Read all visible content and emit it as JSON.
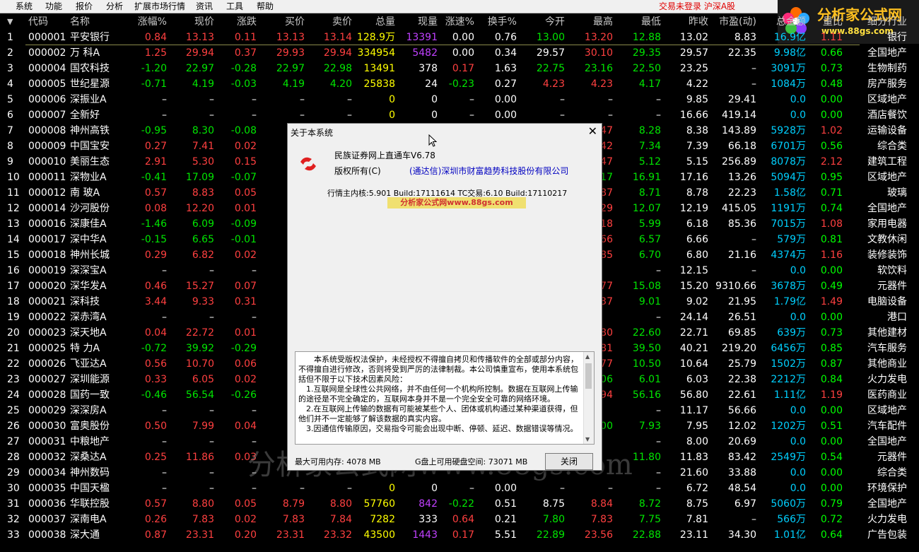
{
  "menu": [
    "系统",
    "功能",
    "报价",
    "分析",
    "扩展市场行情",
    "资讯",
    "工具",
    "帮助"
  ],
  "status": "交易未登录  沪深A股",
  "logo": {
    "text": "分析家公式网",
    "url": "www.88gs.com"
  },
  "headers": [
    "代码",
    "名称",
    "涨幅%",
    "现价",
    "涨跌",
    "买价",
    "卖价",
    "总量",
    "现量",
    "涨速%",
    "换手%",
    "今开",
    "最高",
    "最低",
    "昨收",
    "市盈(动)",
    "总金额",
    "量比",
    "细分行业"
  ],
  "rows": [
    [
      "000001",
      "平安银行",
      "0.84",
      "13.13",
      "0.11",
      "13.13",
      "13.14",
      "128.9万",
      "13391",
      "0.00",
      "0.76",
      "13.00",
      "13.20",
      "12.88",
      "13.02",
      "8.83",
      "16.9亿",
      "1.11",
      "银行"
    ],
    [
      "000002",
      "万 科A",
      "1.25",
      "29.94",
      "0.37",
      "29.93",
      "29.94",
      "334954",
      "5482",
      "0.00",
      "0.34",
      "29.57",
      "30.10",
      "29.35",
      "29.57",
      "22.35",
      "9.98亿",
      "0.66",
      "全国地产"
    ],
    [
      "000004",
      "国农科技",
      "-1.20",
      "22.97",
      "-0.28",
      "22.97",
      "22.98",
      "13491",
      "378",
      "0.17",
      "1.63",
      "22.75",
      "23.16",
      "22.50",
      "23.25",
      "–",
      "3091万",
      "0.73",
      "生物制药"
    ],
    [
      "000005",
      "世纪星源",
      "-0.71",
      "4.19",
      "-0.03",
      "4.19",
      "4.20",
      "25838",
      "24",
      "-0.23",
      "0.27",
      "4.23",
      "4.23",
      "4.17",
      "4.22",
      "–",
      "1084万",
      "0.48",
      "房产服务"
    ],
    [
      "000006",
      "深振业A",
      "–",
      "–",
      "–",
      "–",
      "–",
      "0",
      "0",
      "–",
      "0.00",
      "–",
      "–",
      "–",
      "9.85",
      "29.41",
      "0.0",
      "0.00",
      "区域地产"
    ],
    [
      "000007",
      "全新好",
      "–",
      "–",
      "–",
      "–",
      "–",
      "0",
      "0",
      "–",
      "0.00",
      "–",
      "–",
      "–",
      "16.66",
      "419.14",
      "0.0",
      "0.00",
      "酒店餐饮"
    ],
    [
      "000008",
      "神州高铁",
      "-0.95",
      "8.30",
      "-0.08",
      "",
      "",
      "",
      "",
      "",
      "",
      "",
      "47",
      "8.28",
      "8.38",
      "143.89",
      "5928万",
      "1.02",
      "运输设备"
    ],
    [
      "000009",
      "中国宝安",
      "0.27",
      "7.41",
      "0.02",
      "",
      "",
      "",
      "",
      "",
      "",
      "",
      "42",
      "7.34",
      "7.39",
      "66.18",
      "6701万",
      "0.56",
      "综合类"
    ],
    [
      "000010",
      "美丽生态",
      "2.91",
      "5.30",
      "0.15",
      "",
      "",
      "",
      "",
      "",
      "",
      "",
      "47",
      "5.12",
      "5.15",
      "256.89",
      "8078万",
      "2.12",
      "建筑工程"
    ],
    [
      "000011",
      "深物业A",
      "-0.41",
      "17.09",
      "-0.07",
      "",
      "",
      "",
      "",
      "",
      "",
      "",
      "17",
      "16.91",
      "17.16",
      "13.26",
      "5094万",
      "0.95",
      "区域地产"
    ],
    [
      "000012",
      "南 玻A",
      "0.57",
      "8.83",
      "0.05",
      "",
      "",
      "",
      "",
      "",
      "",
      "",
      "87",
      "8.71",
      "8.78",
      "22.23",
      "1.58亿",
      "0.71",
      "玻璃"
    ],
    [
      "000014",
      "沙河股份",
      "0.08",
      "12.20",
      "0.01",
      "12",
      "",
      "",
      "",
      "",
      "",
      "",
      "29",
      "12.07",
      "12.19",
      "415.05",
      "1191万",
      "0.74",
      "全国地产"
    ],
    [
      "000016",
      "深康佳A",
      "-1.46",
      "6.09",
      "-0.09",
      "",
      "",
      "",
      "",
      "",
      "",
      "",
      "18",
      "5.99",
      "6.18",
      "85.36",
      "7015万",
      "1.08",
      "家用电器"
    ],
    [
      "000017",
      "深中华A",
      "-0.15",
      "6.65",
      "-0.01",
      "",
      "",
      "",
      "",
      "",
      "",
      "",
      "66",
      "6.57",
      "6.66",
      "–",
      "579万",
      "0.81",
      "文教休闲"
    ],
    [
      "000018",
      "神州长城",
      "0.29",
      "6.82",
      "0.02",
      "",
      "",
      "",
      "",
      "",
      "",
      "",
      "85",
      "6.70",
      "6.80",
      "21.16",
      "4374万",
      "1.16",
      "装修装饰"
    ],
    [
      "000019",
      "深深宝A",
      "–",
      "–",
      "–",
      "",
      "",
      "",
      "",
      "",
      "",
      "",
      "",
      "–",
      "12.15",
      "–",
      "0.0",
      "0.00",
      "软饮料"
    ],
    [
      "000020",
      "深华发A",
      "0.46",
      "15.27",
      "0.07",
      "15",
      "",
      "",
      "",
      "",
      "",
      "",
      "77",
      "15.08",
      "15.20",
      "9310.66",
      "3678万",
      "0.49",
      "元器件"
    ],
    [
      "000021",
      "深科技",
      "3.44",
      "9.33",
      "0.31",
      "9",
      "",
      "",
      "",
      "",
      "",
      "",
      "37",
      "9.01",
      "9.02",
      "21.95",
      "1.79亿",
      "1.49",
      "电脑设备"
    ],
    [
      "000022",
      "深赤湾A",
      "–",
      "–",
      "–",
      "",
      "",
      "",
      "",
      "",
      "",
      "",
      "",
      "–",
      "24.14",
      "26.51",
      "0.0",
      "0.00",
      "港口"
    ],
    [
      "000023",
      "深天地A",
      "0.04",
      "22.72",
      "0.01",
      "22",
      "",
      "",
      "",
      "",
      "",
      "",
      "80",
      "22.60",
      "22.71",
      "69.85",
      "639万",
      "0.73",
      "其他建材"
    ],
    [
      "000025",
      "特 力A",
      "-0.72",
      "39.92",
      "-0.29",
      "39",
      "",
      "",
      "",
      "",
      "",
      "",
      "81",
      "39.50",
      "40.21",
      "219.20",
      "6456万",
      "0.85",
      "汽车服务"
    ],
    [
      "000026",
      "飞亚达A",
      "0.56",
      "10.70",
      "0.06",
      "10",
      "",
      "",
      "",
      "",
      "",
      "",
      "77",
      "10.50",
      "10.64",
      "25.79",
      "1502万",
      "0.87",
      "其他商业"
    ],
    [
      "000027",
      "深圳能源",
      "0.33",
      "6.05",
      "0.02",
      "6",
      "",
      "",
      "",
      "",
      "",
      "",
      "06",
      "6.01",
      "6.03",
      "22.38",
      "2212万",
      "0.84",
      "火力发电"
    ],
    [
      "000028",
      "国药一致",
      "-0.46",
      "56.54",
      "-0.26",
      "56",
      "",
      "",
      "",
      "",
      "",
      "",
      "94",
      "56.16",
      "56.80",
      "22.61",
      "1.11亿",
      "1.19",
      "医药商业"
    ],
    [
      "000029",
      "深深房A",
      "–",
      "–",
      "–",
      "",
      "",
      "",
      "",
      "",
      "",
      "",
      "",
      "–",
      "11.17",
      "56.66",
      "0.0",
      "0.00",
      "区域地产"
    ],
    [
      "000030",
      "富奥股份",
      "0.50",
      "7.99",
      "0.04",
      "",
      "",
      "",
      "",
      "",
      "",
      "",
      "00",
      "7.93",
      "7.95",
      "12.02",
      "1202万",
      "0.51",
      "汽车配件"
    ],
    [
      "000031",
      "中粮地产",
      "–",
      "–",
      "–",
      "",
      "",
      "",
      "",
      "",
      "",
      "",
      "",
      "–",
      "8.00",
      "20.69",
      "0.0",
      "0.00",
      "全国地产"
    ],
    [
      "000032",
      "深桑达A",
      "0.25",
      "11.86",
      "0.03",
      "",
      "",
      "",
      "",
      "",
      "",
      "",
      "",
      "11.80",
      "11.83",
      "83.42",
      "2549万",
      "0.54",
      "元器件"
    ],
    [
      "000034",
      "神州数码",
      "–",
      "–",
      "–",
      "",
      "",
      "",
      "",
      "",
      "",
      "",
      "",
      "–",
      "21.60",
      "33.88",
      "0.0",
      "0.00",
      "综合类"
    ],
    [
      "000035",
      "中国天楹",
      "–",
      "–",
      "–",
      "–",
      "–",
      "0",
      "0",
      "–",
      "0.00",
      "–",
      "–",
      "–",
      "6.72",
      "48.54",
      "0.0",
      "0.00",
      "环境保护"
    ],
    [
      "000036",
      "华联控股",
      "0.57",
      "8.80",
      "0.05",
      "8.79",
      "8.80",
      "57760",
      "842",
      "-0.22",
      "0.51",
      "8.75",
      "8.84",
      "8.72",
      "8.75",
      "6.97",
      "5060万",
      "0.79",
      "全国地产"
    ],
    [
      "000037",
      "深南电A",
      "0.26",
      "7.83",
      "0.02",
      "7.83",
      "7.84",
      "7282",
      "333",
      "0.64",
      "0.21",
      "7.80",
      "7.83",
      "7.75",
      "7.81",
      "–",
      "566万",
      "0.72",
      "火力发电"
    ],
    [
      "000038",
      "深大通",
      "0.87",
      "23.31",
      "0.20",
      "23.31",
      "23.32",
      "43500",
      "1443",
      "0.17",
      "5.51",
      "22.89",
      "23.56",
      "22.88",
      "23.11",
      "34.30",
      "1.01亿",
      "0.64",
      "广告包装"
    ]
  ],
  "dialog": {
    "title": "关于本系统",
    "product": "民族证券网上直通车V6.78",
    "copyright_label": "版权所有(C)",
    "copyright_owner": "(通达信)深圳市财富趋势科技股份有限公司",
    "kernel": "行情主内核:5.901 Build:17111614  TC交易:6.10 Build:17110217",
    "watermark": "分析家公式网www.88gs.com",
    "legal_p1": "本系统受版权法保护，未经授权不得擅自拷贝和传播软件的全部或部分内容，不得擅自进行修改，否则将受到严厉的法律制裁。本公司慎重宣布，使用本系统包括但不限于以下技术因素风险：",
    "legal_p2": "1.互联网是全球性公共网络，并不由任何一个机构所控制。数据在互联网上传输的途径是不完全确定的，互联网本身并不是一个完全安全可靠的网络环境。",
    "legal_p3": "2.在互联网上传输的数据有可能被某些个人、团体或机构通过某种渠道获得，但他们并不一定能够了解该数据的真实内容。",
    "legal_p4": "3.因通信传输原因，交易指令可能会出现中断、停顿、延迟、数据错误等情况。",
    "memory": "最大可用内存: 4078 MB",
    "disk": "G盘上可用硬盘空间: 73071 MB",
    "close_button": "关闭"
  },
  "background_watermark": "分析家公式网www.88gs.com",
  "colors": {
    "up": "#ff4040",
    "down": "#00e600",
    "neutral": "#ffffff",
    "volume": "#ffff00",
    "current_volume": "#c040ff",
    "cyan": "#00d0ff",
    "highlight_green": "#00ff00"
  }
}
